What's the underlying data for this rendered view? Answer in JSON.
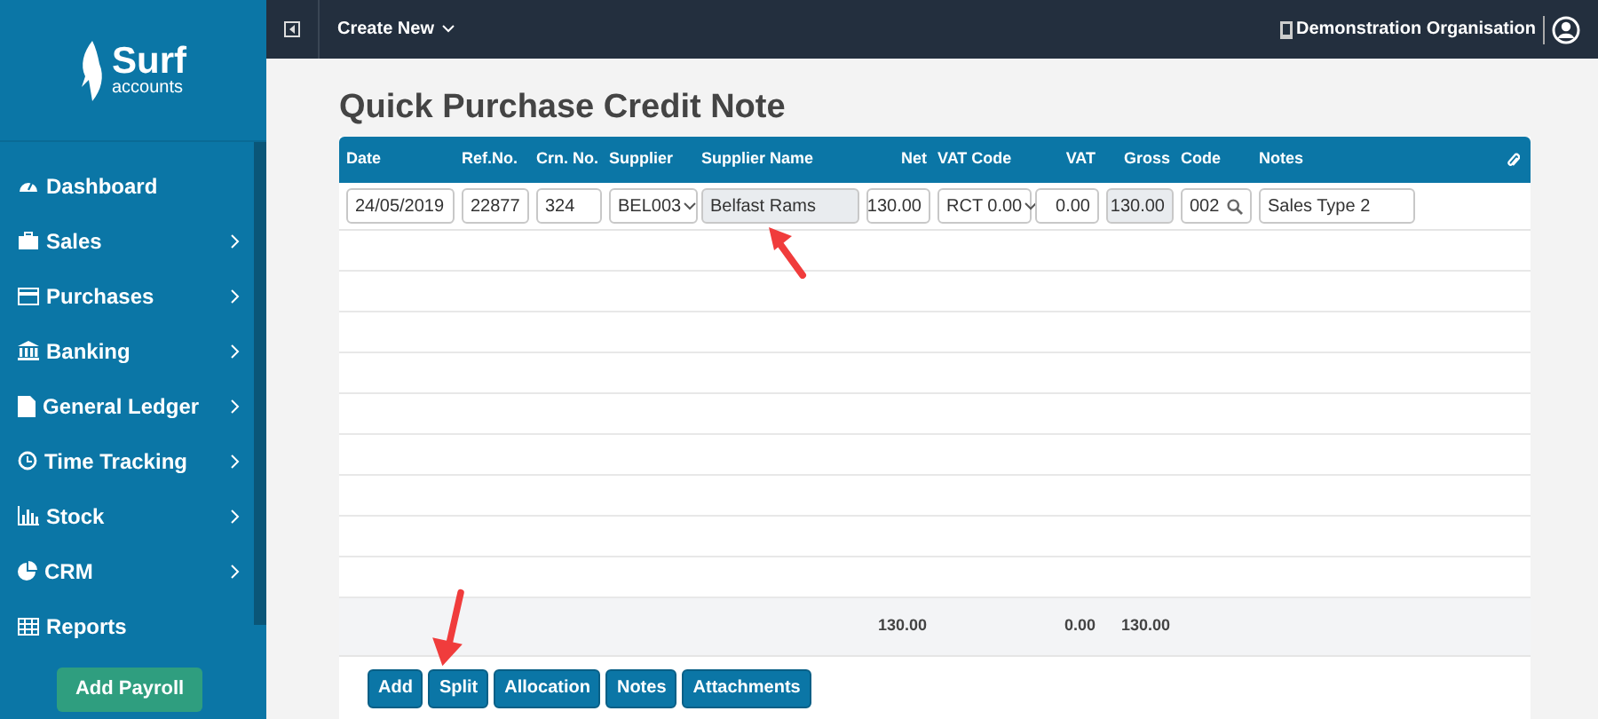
{
  "logo": {
    "name": "Surf",
    "tagline": "accounts"
  },
  "sidebar": {
    "items": [
      {
        "label": "Dashboard",
        "submenu": false
      },
      {
        "label": "Sales",
        "submenu": true
      },
      {
        "label": "Purchases",
        "submenu": true
      },
      {
        "label": "Banking",
        "submenu": true
      },
      {
        "label": "General Ledger",
        "submenu": true
      },
      {
        "label": "Time Tracking",
        "submenu": true
      },
      {
        "label": "Stock",
        "submenu": true
      },
      {
        "label": "CRM",
        "submenu": true
      },
      {
        "label": "Reports",
        "submenu": false
      }
    ],
    "action": "Add Payroll"
  },
  "topbar": {
    "create_menu": "Create New",
    "organisation": "Demonstration Organisation"
  },
  "page_title": "Quick Purchase Credit Note",
  "table": {
    "columns": [
      "Date",
      "Ref.No.",
      "Crn. No.",
      "Supplier",
      "Supplier Name",
      "Net",
      "VAT Code",
      "VAT",
      "Gross",
      "Code",
      "Notes"
    ],
    "entry": [
      {
        "kind": "date",
        "value": "24/05/2019"
      },
      {
        "kind": "text",
        "value": "22877"
      },
      {
        "kind": "text",
        "value": "324"
      },
      {
        "kind": "select",
        "value": "BEL003"
      },
      {
        "kind": "readonly",
        "value": "Belfast Rams"
      },
      {
        "kind": "number",
        "value": "130.00"
      },
      {
        "kind": "select",
        "value": "RCT 0.00"
      },
      {
        "kind": "number",
        "value": "0.00"
      },
      {
        "kind": "readonly-number",
        "value": "130.00"
      },
      {
        "kind": "lookup",
        "value": "002"
      },
      {
        "kind": "text",
        "value": "Sales Type 2"
      }
    ],
    "totals": {
      "net": "130.00",
      "vat": "0.00",
      "gross": "130.00"
    }
  },
  "buttons": [
    "Add",
    "Split",
    "Allocation",
    "Notes",
    "Attachments"
  ]
}
